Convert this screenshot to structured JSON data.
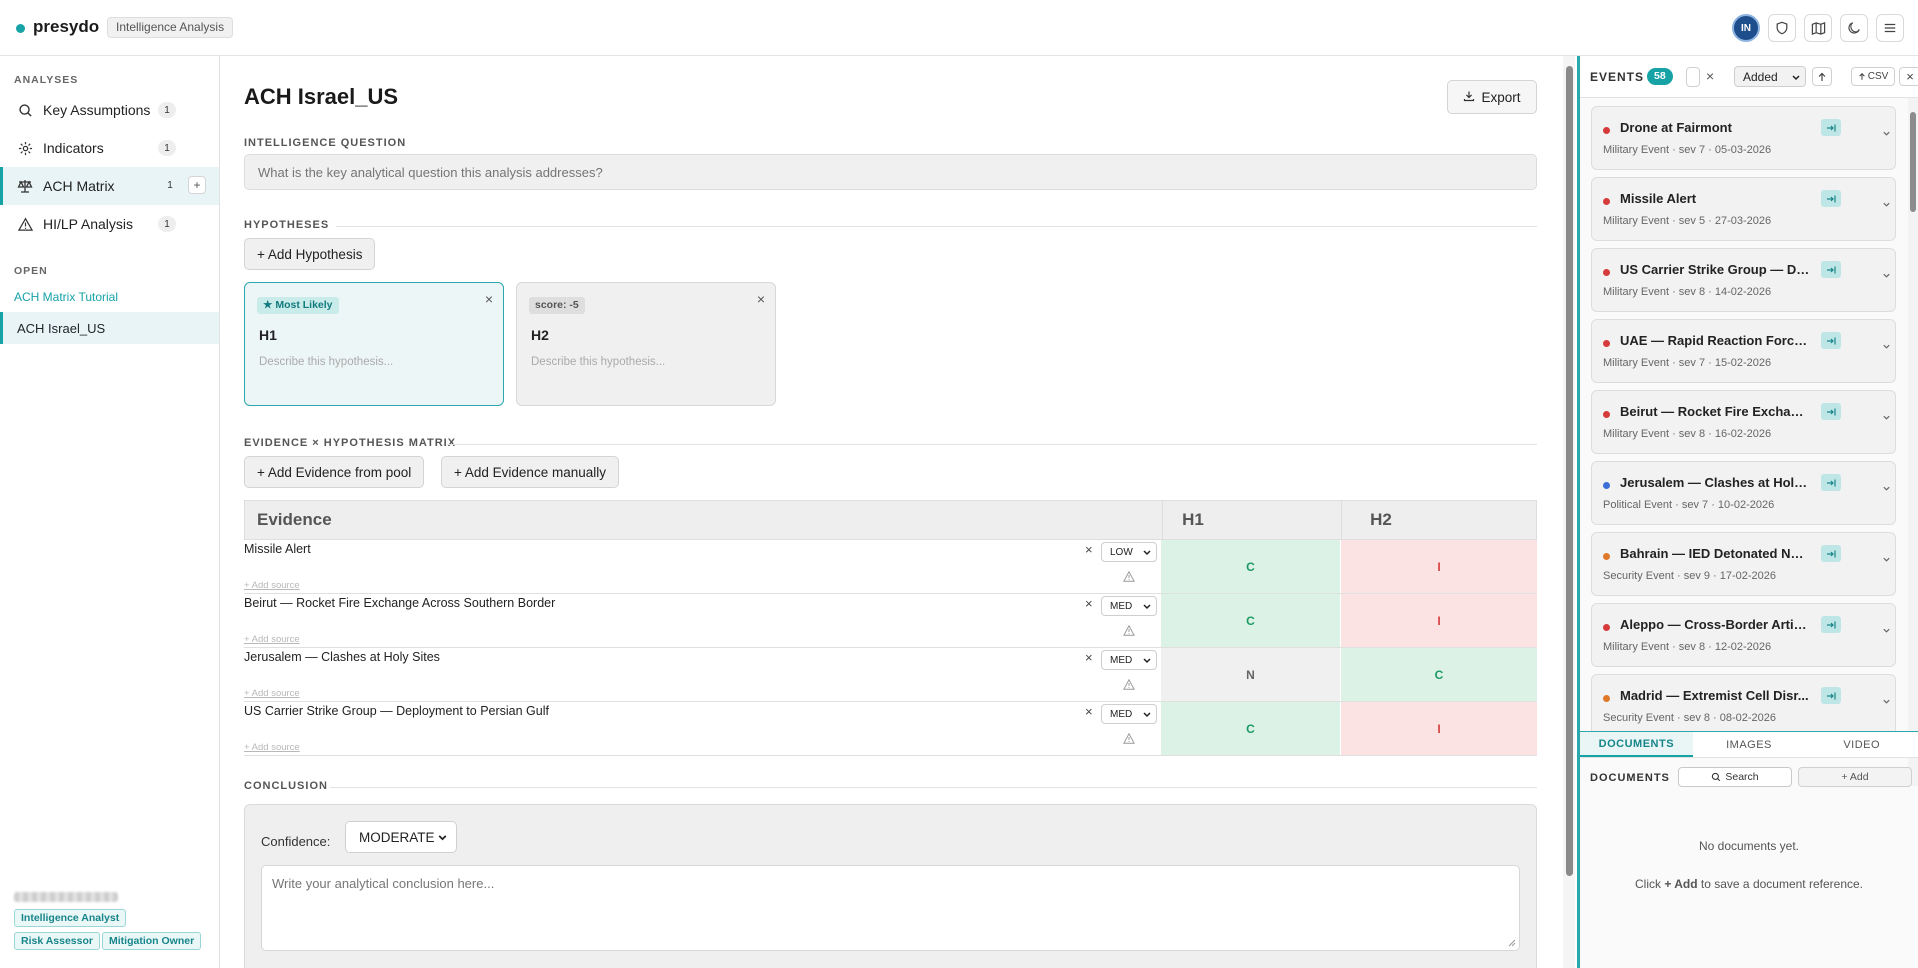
{
  "topbar": {
    "brand": "presydo",
    "tag": "Intelligence Analysis",
    "avatar_initials": "IN",
    "icons": [
      "shield-icon",
      "map-icon",
      "moon-icon",
      "menu-icon"
    ]
  },
  "sidebar": {
    "analyses_label": "ANALYSES",
    "items": [
      {
        "label": "Key Assumptions",
        "count": "1",
        "icon": "search-icon"
      },
      {
        "label": "Indicators",
        "count": "1",
        "icon": "sparkle-icon"
      },
      {
        "label": "ACH Matrix",
        "count": "1",
        "icon": "scales-icon",
        "plus": "+"
      },
      {
        "label": "HI/LP Analysis",
        "count": "1",
        "icon": "warning-icon"
      }
    ],
    "open_label": "OPEN",
    "open_link": "ACH Matrix Tutorial",
    "open_item": "ACH Israel_US",
    "roles": [
      "Intelligence Analyst",
      "Risk Assessor",
      "Mitigation Owner"
    ]
  },
  "main": {
    "title": "ACH Israel_US",
    "export_label": "Export",
    "question_label": "INTELLIGENCE QUESTION",
    "question_placeholder": "What is the key analytical question this analysis addresses?",
    "hypotheses_label": "HYPOTHESES",
    "add_hypothesis": "+ Add Hypothesis",
    "hypotheses": [
      {
        "badge": "★ Most Likely",
        "name": "H1",
        "desc": "Describe this hypothesis...",
        "close": "×"
      },
      {
        "badge": "score: -5",
        "name": "H2",
        "desc": "Describe this hypothesis...",
        "close": "×"
      }
    ],
    "matrix_label": "EVIDENCE × HYPOTHESIS MATRIX",
    "add_from_pool": "+ Add Evidence from pool",
    "add_manually": "+ Add Evidence manually",
    "matrix": {
      "evidence_header": "Evidence",
      "hyp_headers": [
        "H1",
        "H2"
      ],
      "add_source": "+ Add source",
      "rows": [
        {
          "title": "Missile Alert",
          "weight": "LOW",
          "h1": "C",
          "h2": "I"
        },
        {
          "title": "Beirut — Rocket Fire Exchange Across Southern Border",
          "weight": "MED",
          "h1": "C",
          "h2": "I"
        },
        {
          "title": "Jerusalem — Clashes at Holy Sites",
          "weight": "MED",
          "h1": "N",
          "h2": "C"
        },
        {
          "title": "US Carrier Strike Group — Deployment to Persian Gulf",
          "weight": "MED",
          "h1": "C",
          "h2": "I"
        }
      ]
    },
    "conclusion_label": "CONCLUSION",
    "confidence_label": "Confidence:",
    "confidence_value": "MODERATE",
    "conclusion_placeholder": "Write your analytical conclusion here..."
  },
  "events": {
    "title": "EVENTS",
    "count": "58",
    "clear": "×",
    "sort": "Added",
    "csv": "CSV",
    "close": "×",
    "items": [
      {
        "name": "Drone at Fairmont",
        "meta": "Military Event · sev 7 · 05-03-2026",
        "color": "#d63a3a"
      },
      {
        "name": "Missile Alert",
        "meta": "Military Event · sev 5 · 27-03-2026",
        "color": "#d63a3a"
      },
      {
        "name": "US Carrier Strike Group — De...",
        "meta": "Military Event · sev 8 · 14-02-2026",
        "color": "#d63a3a"
      },
      {
        "name": "UAE — Rapid Reaction Force ...",
        "meta": "Military Event · sev 7 · 15-02-2026",
        "color": "#d63a3a"
      },
      {
        "name": "Beirut — Rocket Fire Exchang...",
        "meta": "Military Event · sev 8 · 16-02-2026",
        "color": "#d63a3a"
      },
      {
        "name": "Jerusalem — Clashes at Holy ...",
        "meta": "Political Event · sev 7 · 10-02-2026",
        "color": "#3b6fd6"
      },
      {
        "name": "Bahrain — IED Detonated Nea...",
        "meta": "Security Event · sev 9 · 17-02-2026",
        "color": "#e0782a"
      },
      {
        "name": "Aleppo — Cross-Border Artill...",
        "meta": "Military Event · sev 8 · 12-02-2026",
        "color": "#d63a3a"
      },
      {
        "name": "Madrid — Extremist Cell Disr...",
        "meta": "Security Event · sev 8 · 08-02-2026",
        "color": "#e0782a"
      }
    ],
    "tabs": [
      "DOCUMENTS",
      "IMAGES",
      "VIDEO"
    ],
    "documents_label": "DOCUMENTS",
    "search_label": "Search",
    "add_label": "+ Add",
    "empty_title": "No documents yet.",
    "empty_hint_pre": "Click",
    "empty_hint_bold": "+ Add",
    "empty_hint_post": "to save a document reference."
  }
}
